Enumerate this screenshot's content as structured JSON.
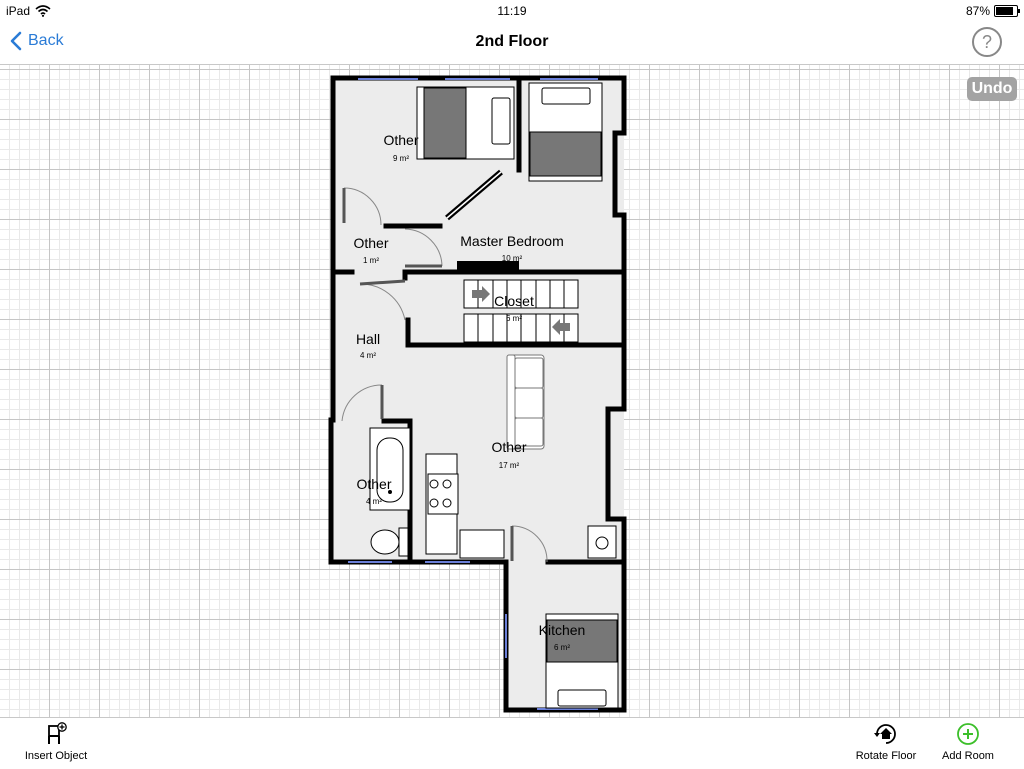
{
  "status_bar": {
    "device": "iPad",
    "time": "11:19",
    "battery": "87%"
  },
  "nav": {
    "back_label": "Back",
    "title": "2nd Floor",
    "help_label": "?"
  },
  "canvas": {
    "undo_label": "Undo"
  },
  "rooms": [
    {
      "name": "Other",
      "area": "9 m²"
    },
    {
      "name": "Master Bedroom",
      "area": "10 m²"
    },
    {
      "name": "Other",
      "area": "1 m²"
    },
    {
      "name": "Closet",
      "area": "6 m²"
    },
    {
      "name": "Hall",
      "area": "4 m²"
    },
    {
      "name": "Other",
      "area": "17 m²"
    },
    {
      "name": "Other",
      "area": "4 m²"
    },
    {
      "name": "Kitchen",
      "area": "6 m²"
    }
  ],
  "toolbar": {
    "insert_object": "Insert Object",
    "rotate_floor": "Rotate Floor",
    "add_room": "Add Room"
  },
  "colors": {
    "accent": "#2a7bd6",
    "add_room_green": "#3cbf2a",
    "room_fill": "#ececec",
    "wall": "#000000",
    "undo_bg": "#a3a3a3"
  }
}
